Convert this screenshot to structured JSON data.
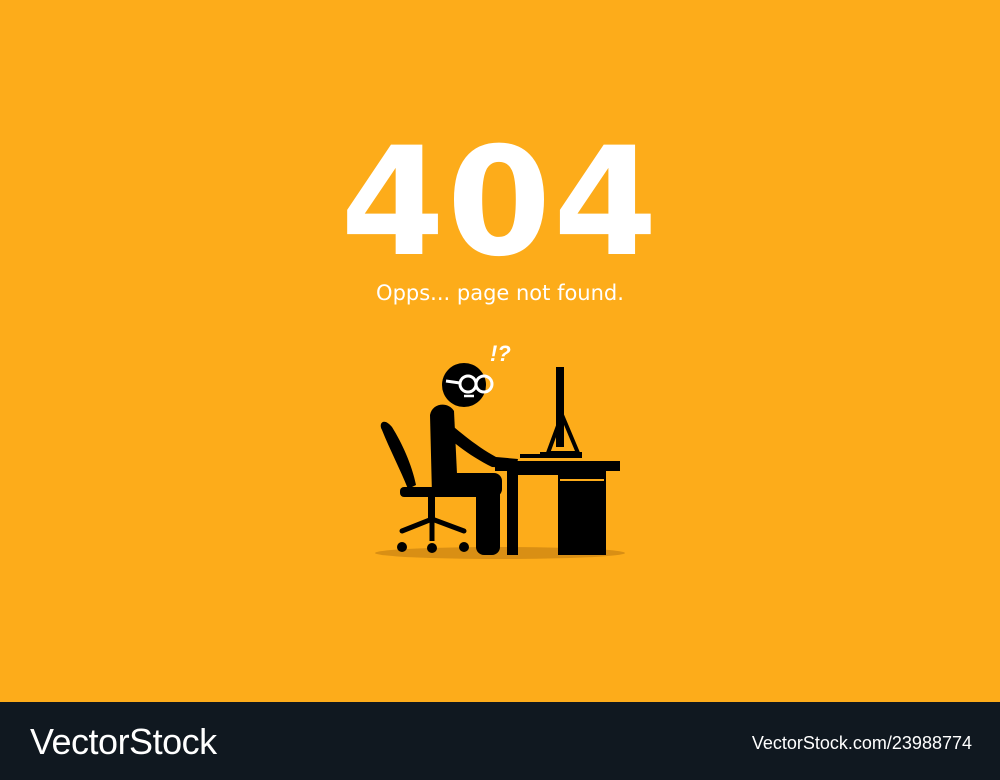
{
  "hero": {
    "code": "404",
    "message": "Opps... page not found."
  },
  "illustration": {
    "exclaim": "!?"
  },
  "footer": {
    "brand": "VectorStock",
    "image_id": "VectorStock.com/23988774"
  },
  "colors": {
    "background": "#fdac1a",
    "text": "#ffffff",
    "figure": "#000000",
    "shadow": "#d98f14",
    "footer": "#101820"
  },
  "icons": [
    "person-at-desk-illustration",
    "computer-monitor-icon",
    "office-chair-icon",
    "desk-icon",
    "glasses-icon"
  ]
}
